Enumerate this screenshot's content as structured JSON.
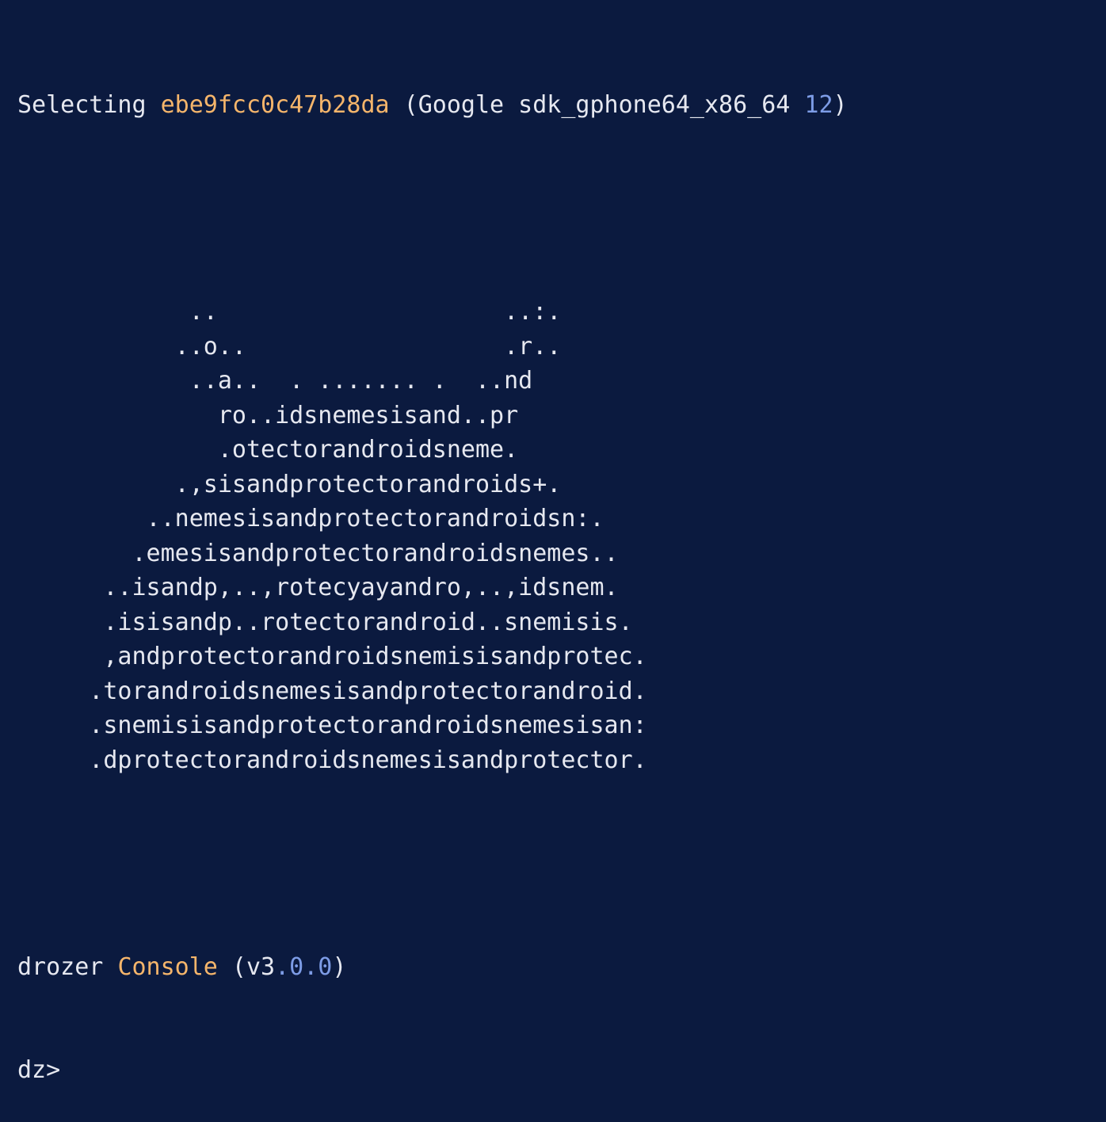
{
  "selecting_line": {
    "prefix": "Selecting ",
    "device_id": "ebe9fcc0c47b28da",
    "device_desc_open": " (Google sdk_gphone64_x86_64 ",
    "api_level": "12",
    "device_desc_close": ")"
  },
  "ascii_art": [
    "            ..                    ..:.",
    "           ..o..                  .r..",
    "            ..a..  . ....... .  ..nd",
    "              ro..idsnemesisand..pr",
    "              .otectorandroidsneme.",
    "           .,sisandprotectorandroids+.",
    "         ..nemesisandprotectorandroidsn:.",
    "        .emesisandprotectorandroidsnemes..",
    "      ..isandp,..,rotecyayandro,..,idsnem.",
    "      .isisandp..rotectorandroid..snemisis.",
    "      ,andprotectorandroidsnemisisandprotec.",
    "     .torandroidsnemesisandprotectorandroid.",
    "     .snemisisandprotectorandroidsnemesisan:",
    "     .dprotectorandroidsnemesisandprotector."
  ],
  "console_line": {
    "name": "drozer ",
    "console": "Console",
    "version_open": " (v3",
    "version_minor": ".0.0",
    "version_close": ")"
  },
  "prompt": "dz>"
}
